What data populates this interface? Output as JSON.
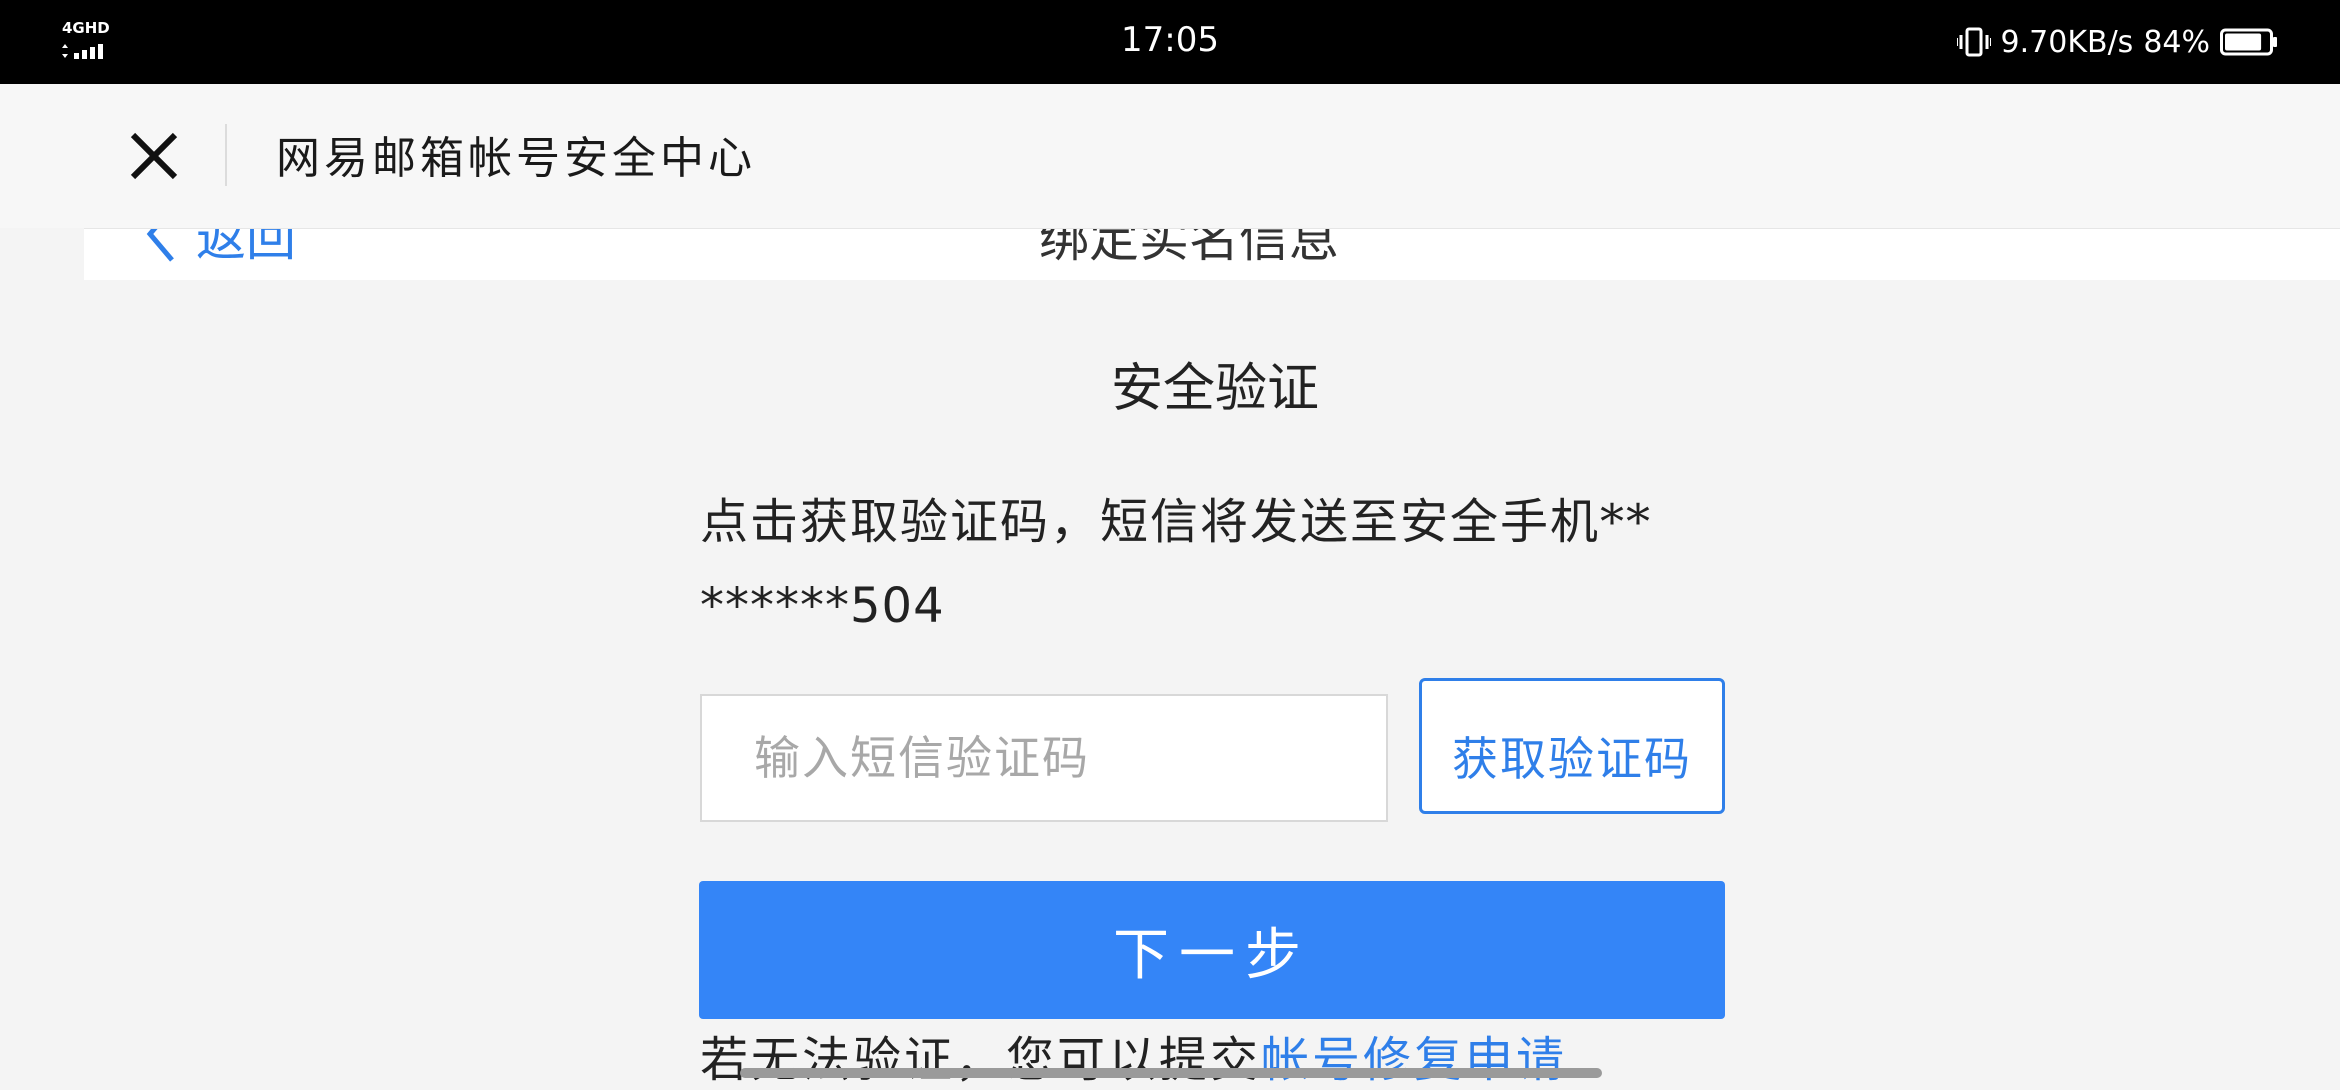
{
  "status_bar": {
    "network": "4GHD",
    "time": "17:05",
    "speed": "9.70KB/s",
    "battery": "84%",
    "battery_level": 0.84,
    "icons": [
      "signal-icon",
      "vibrate-icon",
      "battery-icon"
    ]
  },
  "title_bar": {
    "title": "网易邮箱帐号安全中心",
    "close_icon": "close-icon"
  },
  "page_header": {
    "back_label": "返回",
    "title": "绑定实名信息"
  },
  "verify": {
    "title": "安全验证",
    "desc_line1": "点击获取验证码，短信将发送至安全手机**",
    "desc_line2": "******504",
    "input_placeholder": "输入短信验证码",
    "input_value": "",
    "get_code_label": "获取验证码",
    "next_label": "下一步",
    "footer_text": "若无法验证，您可以提交",
    "footer_link": "帐号修复申请"
  },
  "colors": {
    "accent": "#3485f7",
    "link": "#2f7fe9",
    "background": "#f4f4f4"
  }
}
